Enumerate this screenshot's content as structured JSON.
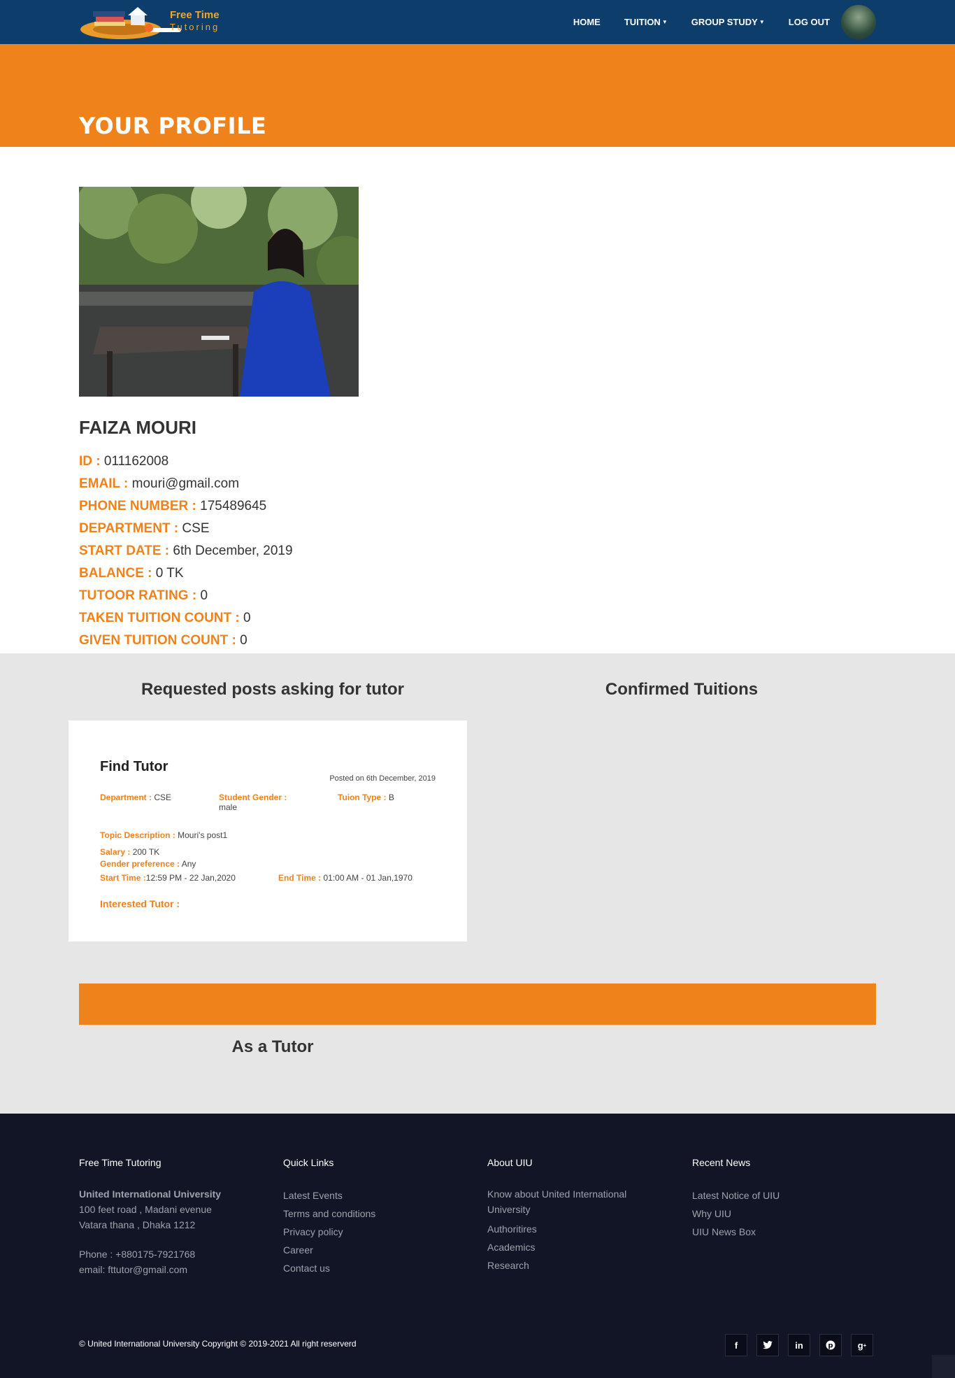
{
  "brand": {
    "name_line1": "Free Time",
    "name_line2": "Tutoring"
  },
  "nav": {
    "home": "HOME",
    "tuition": "TUITION",
    "group_study": "GROUP STUDY",
    "logout": "LOG OUT"
  },
  "hero": {
    "title": "YOUR PROFILE"
  },
  "profile": {
    "name": "FAIZA MOURI",
    "fields": [
      {
        "label": "ID :",
        "value": "011162008"
      },
      {
        "label": "EMAIL :",
        "value": "mouri@gmail.com"
      },
      {
        "label": "PHONE NUMBER :",
        "value": "175489645"
      },
      {
        "label": "DEPARTMENT :",
        "value": "CSE"
      },
      {
        "label": "START DATE :",
        "value": "6th December, 2019"
      },
      {
        "label": "BALANCE :",
        "value": "0 TK"
      },
      {
        "label": "TUTOOR RATING :",
        "value": "0"
      },
      {
        "label": "TAKEN TUITION COUNT :",
        "value": "0"
      },
      {
        "label": "GIVEN TUITION COUNT :",
        "value": "0"
      }
    ]
  },
  "posts": {
    "requested_heading": "Requested posts asking for tutor",
    "confirmed_heading": "Confirmed Tuitions",
    "tutor_heading": "As a Tutor",
    "card": {
      "title": "Find Tutor",
      "posted": "Posted on 6th December, 2019",
      "department_label": "Department :",
      "department": "CSE",
      "gender_label": "Student Gender :",
      "gender": "male",
      "type_label": "Tuion Type :",
      "type": "B",
      "topic_label": "Topic Description :",
      "topic": "Mouri's post1",
      "salary_label": "Salary :",
      "salary": "200 TK",
      "gender_pref_label": "Gender preference :",
      "gender_pref": "Any",
      "start_label": "Start Time :",
      "start": "12:59 PM - 22 Jan,2020",
      "end_label": "End Time :",
      "end": "01:00 AM - 01 Jan,1970",
      "interested_label": "Interested Tutor :"
    }
  },
  "footer": {
    "col1": {
      "heading": "Free Time Tutoring",
      "org": "United International University",
      "addr1": "100 feet road , Madani evenue",
      "addr2": "Vatara thana , Dhaka 1212",
      "phone": "Phone : +880175-7921768",
      "email": "email: fttutor@gmail.com"
    },
    "col2": {
      "heading": "Quick Links",
      "links": [
        "Latest Events",
        "Terms and conditions",
        "Privacy policy",
        "Career",
        "Contact us"
      ]
    },
    "col3": {
      "heading": "About UIU",
      "links": [
        "Know about United International University",
        "Authoritires",
        "Academics",
        "Research"
      ]
    },
    "col4": {
      "heading": "Recent News",
      "links": [
        "Latest Notice of UIU",
        "Why UIU",
        "UIU News Box"
      ]
    },
    "copyright": "© United International University Copyright © 2019-2021 All right reserverd",
    "social": [
      "facebook-icon",
      "twitter-icon",
      "linkedin-icon",
      "pinterest-icon",
      "google-plus-icon"
    ]
  },
  "colors": {
    "navy": "#0c3d6b",
    "orange": "#f0821c",
    "footer": "#111525",
    "section_gray": "#e6e6e6"
  }
}
